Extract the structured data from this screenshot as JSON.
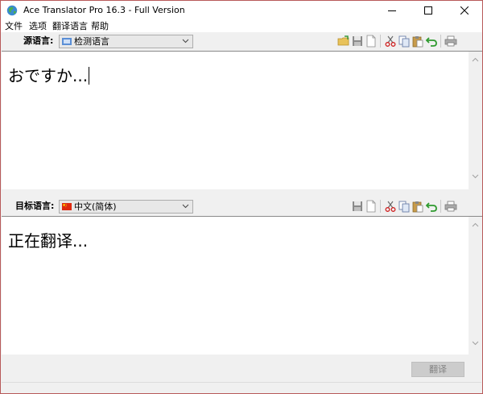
{
  "window": {
    "title": "Ace Translator Pro  16.3 - Full Version"
  },
  "menu": {
    "items": [
      "文件",
      "选项",
      "翻译语言",
      "帮助"
    ]
  },
  "source": {
    "label": "源语言:",
    "language": "检测语言",
    "text": "おですか..."
  },
  "target": {
    "label": "目标语言:",
    "language": "中文(简体)",
    "text": "正在翻译..."
  },
  "actions": {
    "translate_label": "翻译"
  },
  "colors": {
    "border": "#b85a5a",
    "toolbar_bg": "#f0f0f0",
    "flag_red": "#de2910",
    "flag_yellow": "#ffde00"
  }
}
